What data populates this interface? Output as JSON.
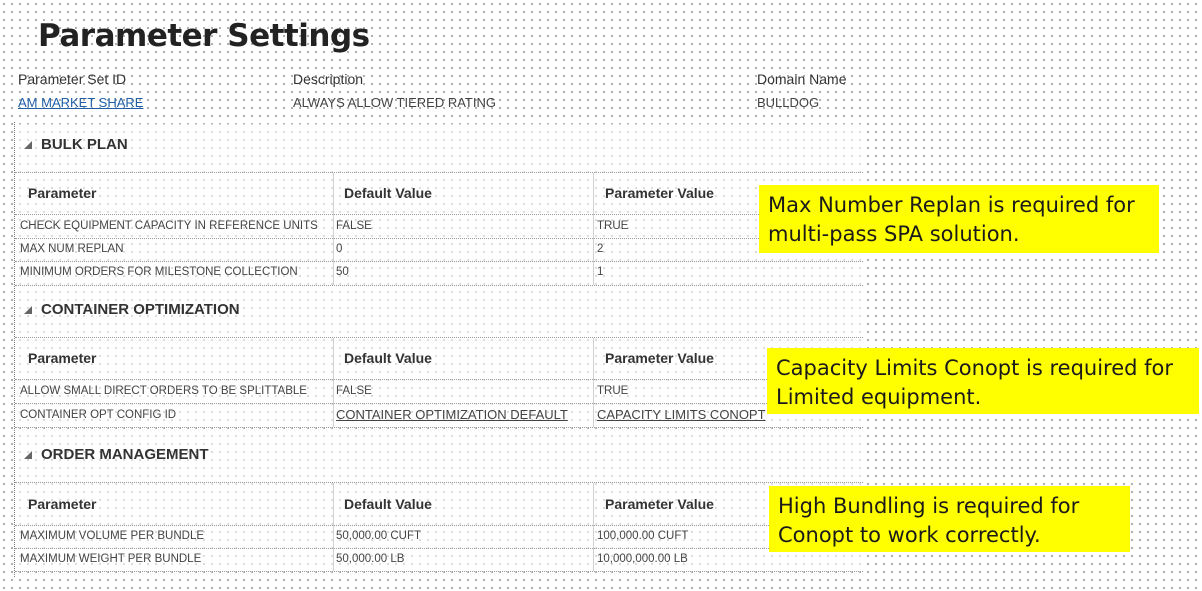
{
  "page": {
    "title": "Parameter Settings"
  },
  "header": {
    "parameter_set_id_label": "Parameter Set ID",
    "parameter_set_id_value": "AM MARKET SHARE",
    "description_label": "Description",
    "description_value": "ALWAYS ALLOW TIERED RATING",
    "domain_name_label": "Domain Name",
    "domain_name_value": "BULLDOG"
  },
  "columns": {
    "parameter": "Parameter",
    "default_value": "Default Value",
    "parameter_value": "Parameter Value"
  },
  "sections": [
    {
      "title": "BULK PLAN",
      "rows": [
        {
          "parameter": "CHECK EQUIPMENT CAPACITY IN REFERENCE UNITS",
          "default": "FALSE",
          "value": "TRUE"
        },
        {
          "parameter": "MAX NUM REPLAN",
          "default": "0",
          "value": "2"
        },
        {
          "parameter": "MINIMUM ORDERS FOR MILESTONE COLLECTION",
          "default": "50",
          "value": "1"
        }
      ]
    },
    {
      "title": "CONTAINER OPTIMIZATION",
      "rows": [
        {
          "parameter": "ALLOW SMALL DIRECT ORDERS TO BE SPLITTABLE",
          "default": "FALSE",
          "value": "TRUE"
        },
        {
          "parameter": "CONTAINER OPT CONFIG ID",
          "default": "CONTAINER OPTIMIZATION DEFAULT",
          "value": "CAPACITY LIMITS CONOPT"
        }
      ]
    },
    {
      "title": "ORDER MANAGEMENT",
      "rows": [
        {
          "parameter": "MAXIMUM VOLUME PER BUNDLE",
          "default": "50,000.00 CUFT",
          "value": "100,000.00 CUFT"
        },
        {
          "parameter": "MAXIMUM WEIGHT PER BUNDLE",
          "default": "50,000.00 LB",
          "value": "10,000,000.00 LB"
        }
      ]
    }
  ],
  "notes": [
    {
      "line1": "Max Number Replan is required for",
      "line2": "multi-pass SPA solution."
    },
    {
      "line1": "Capacity Limits Conopt is required for",
      "line2": "Limited equipment."
    },
    {
      "line1": "High Bundling is required for",
      "line2": "Conopt to work correctly."
    }
  ],
  "colors": {
    "highlight": "#ffff00",
    "link": "#1f5fa8"
  }
}
